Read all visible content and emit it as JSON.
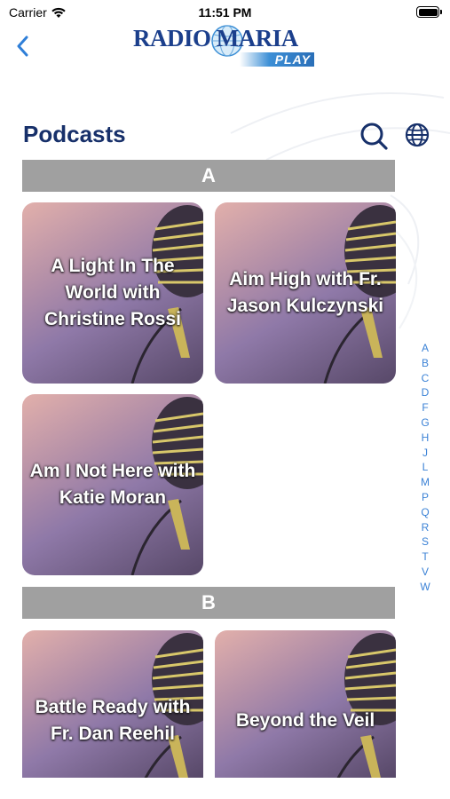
{
  "status_bar": {
    "carrier": "Carrier",
    "time": "11:51 PM"
  },
  "nav": {
    "logo_main": "RADIO MARIA",
    "logo_sub": "PLAY"
  },
  "header": {
    "title": "Podcasts"
  },
  "sections": [
    {
      "letter": "A",
      "podcasts": [
        "A Light In The World with Christine Rossi",
        "Aim High with Fr. Jason Kulczynski",
        "Am I Not Here with Katie Moran"
      ]
    },
    {
      "letter": "B",
      "podcasts": [
        "Battle Ready with Fr. Dan Reehil",
        "Beyond the Veil"
      ]
    }
  ],
  "alpha_index": [
    "A",
    "B",
    "C",
    "D",
    "F",
    "G",
    "H",
    "J",
    "L",
    "M",
    "P",
    "Q",
    "R",
    "S",
    "T",
    "V",
    "W"
  ],
  "colors": {
    "title": "#17306a",
    "accent": "#3b82d6",
    "section_header": "#a0a0a0"
  }
}
